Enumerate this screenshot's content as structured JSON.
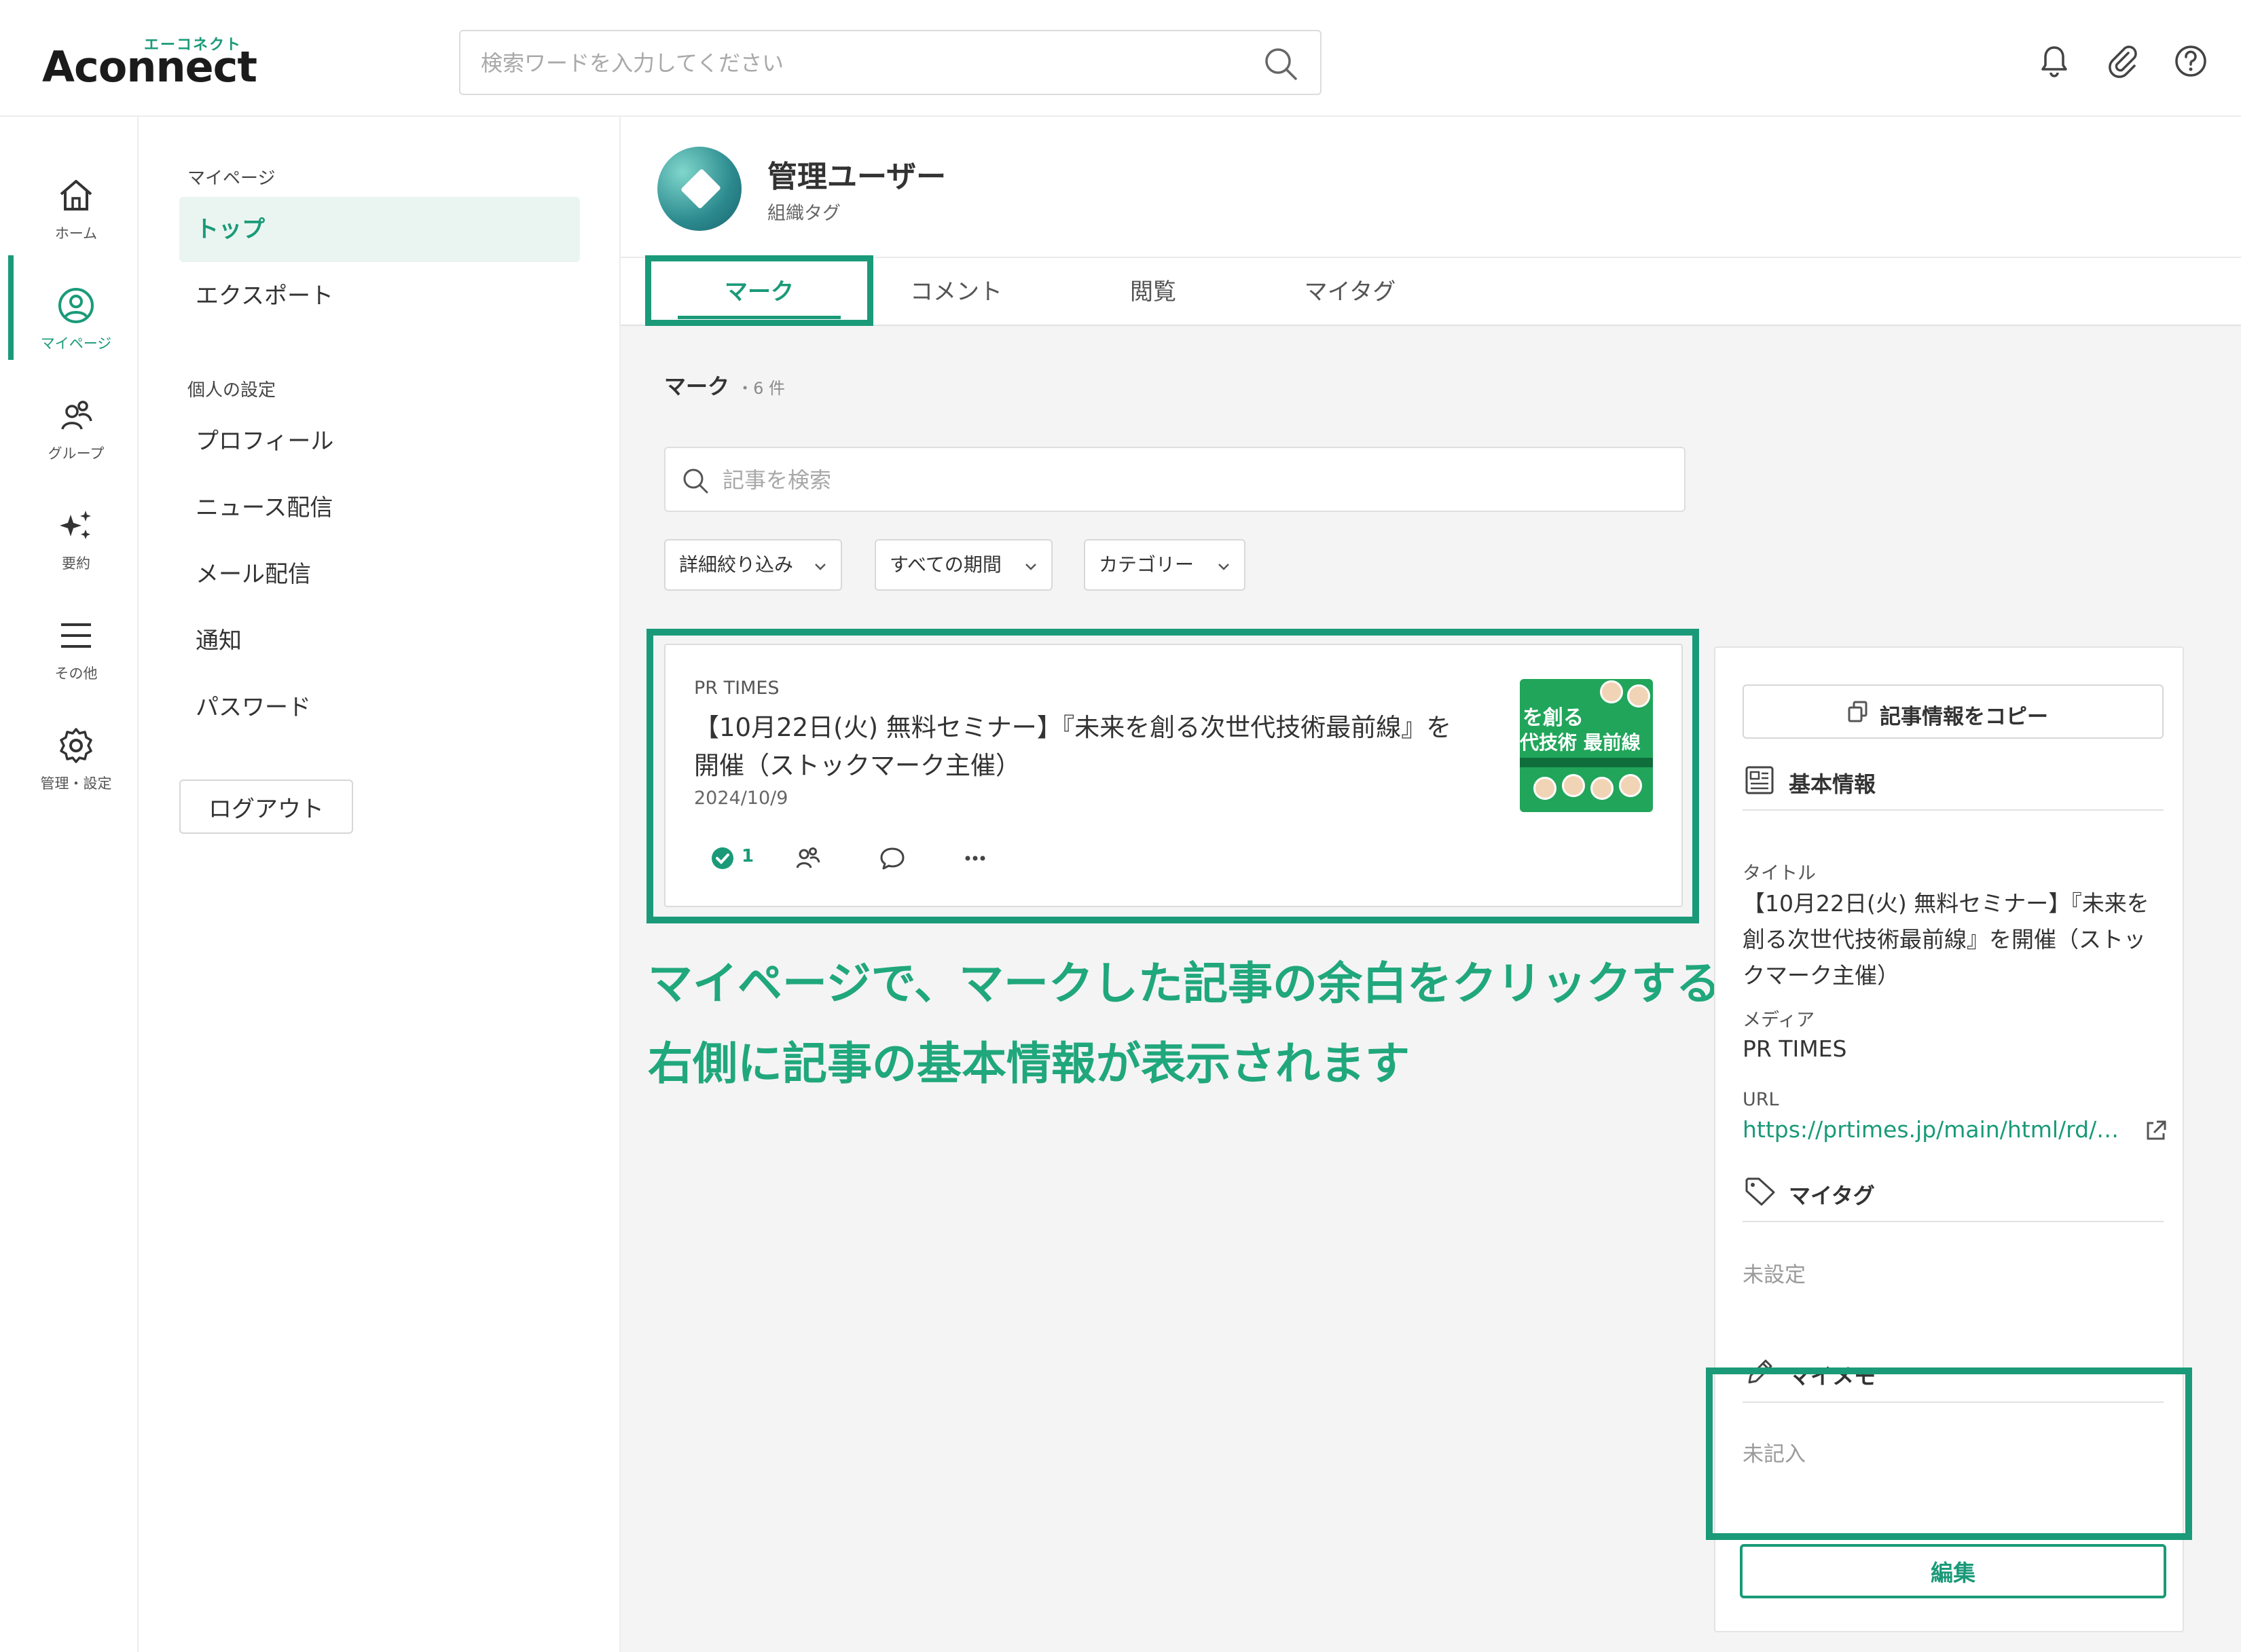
{
  "brand": {
    "logo_text": "Aconnect",
    "logo_kana": "エーコネクト",
    "accent": "#1a9a78",
    "highlight": "#20a77c"
  },
  "header": {
    "search_placeholder": "検索ワードを入力してください",
    "icons": [
      "bell-icon",
      "paperclip-icon",
      "help-icon"
    ]
  },
  "rail": {
    "items": [
      {
        "label": "ホーム",
        "icon": "home-icon"
      },
      {
        "label": "マイページ",
        "icon": "user-circle-icon"
      },
      {
        "label": "グループ",
        "icon": "group-icon"
      },
      {
        "label": "要約",
        "icon": "sparkle-icon"
      },
      {
        "label": "その他",
        "icon": "menu-icon"
      },
      {
        "label": "管理・設定",
        "icon": "gear-icon"
      }
    ]
  },
  "menu": {
    "section1": "マイページ",
    "items1": [
      "トップ",
      "エクスポート"
    ],
    "section2": "個人の設定",
    "items2": [
      "プロフィール",
      "ニュース配信",
      "メール配信",
      "通知",
      "パスワード"
    ],
    "logout": "ログアウト"
  },
  "profile": {
    "name": "管理ユーザー",
    "tag": "組織タグ"
  },
  "tabs": [
    "マーク",
    "コメント",
    "閲覧",
    "マイタグ"
  ],
  "list": {
    "heading": "マーク",
    "count": "・6 件",
    "search_placeholder": "記事を検索",
    "filters": [
      "詳細絞り込み",
      "すべての期間",
      "カテゴリー"
    ]
  },
  "article": {
    "media": "PR TIMES",
    "title": "【10月22日(火) 無料セミナー】『未来を創る次世代技術最前線』を開催（ストックマーク主催）",
    "date": "2024/10/9",
    "mark_count": "1",
    "thumb_text1": "を創る",
    "thumb_text2": "代技術 最前線"
  },
  "annotation": {
    "line1": "マイページで、マークした記事の余白をクリックすると",
    "line2": "右側に記事の基本情報が表示されます"
  },
  "panel": {
    "copy_label": "記事情報をコピー",
    "basic_heading": "基本情報",
    "title_label": "タイトル",
    "title_value": "【10月22日(火) 無料セミナー】『未来を創る次世代技術最前線』を開催（ストックマーク主催）",
    "media_label": "メディア",
    "media_value": "PR TIMES",
    "url_label": "URL",
    "url_value": "https://prtimes.jp/main/html/rd/…",
    "mytag_heading": "マイタグ",
    "mytag_value": "未設定",
    "memo_heading": "マイメモ",
    "memo_value": "未記入",
    "edit_label": "編集"
  }
}
